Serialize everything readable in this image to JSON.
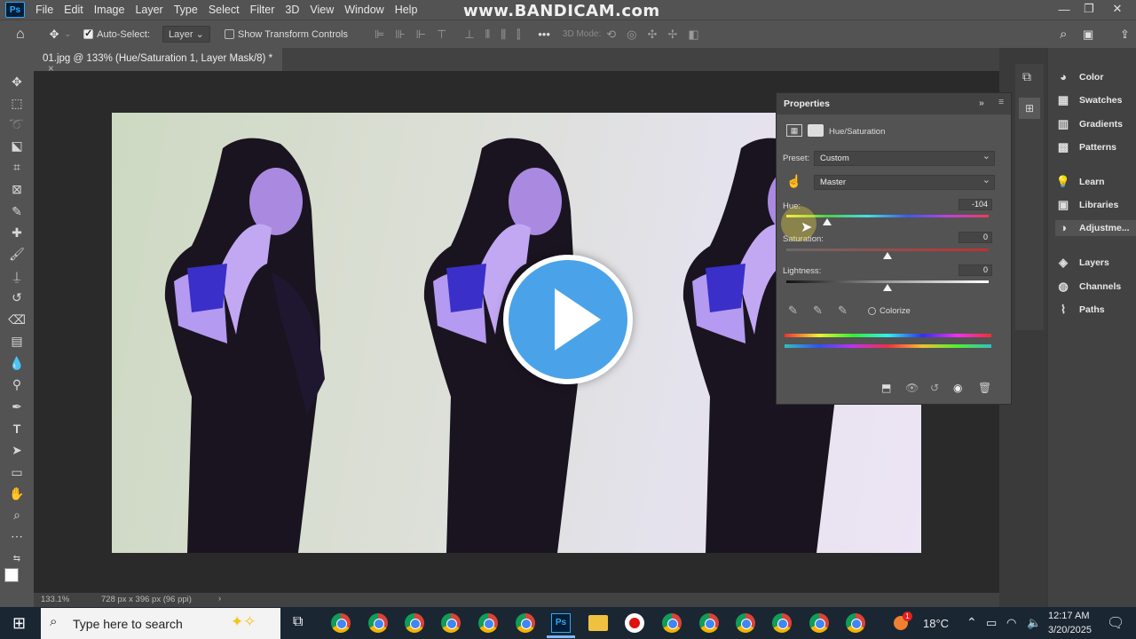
{
  "watermark": "www.BANDICAM.com",
  "menu": [
    "File",
    "Edit",
    "Image",
    "Layer",
    "Type",
    "Select",
    "Filter",
    "3D",
    "View",
    "Window",
    "Help"
  ],
  "options": {
    "auto_select_label": "Auto-Select:",
    "auto_select_value": "Layer",
    "transform_label": "Show Transform Controls",
    "mode3d_label": "3D Mode:"
  },
  "document": {
    "tab_title": "01.jpg @ 133% (Hue/Saturation 1, Layer Mask/8) *",
    "zoom": "133.1%",
    "dimensions": "728 px x 396 px (96 ppi)"
  },
  "right_panels": [
    {
      "label": "Color",
      "icon": "color-wheel-icon"
    },
    {
      "label": "Swatches",
      "icon": "grid-icon"
    },
    {
      "label": "Gradients",
      "icon": "gradient-icon"
    },
    {
      "label": "Patterns",
      "icon": "pattern-icon"
    },
    {
      "label": "Learn",
      "icon": "lightbulb-icon"
    },
    {
      "label": "Libraries",
      "icon": "library-icon"
    },
    {
      "label": "Adjustme...",
      "icon": "adjustment-icon"
    },
    {
      "label": "Layers",
      "icon": "layers-icon"
    },
    {
      "label": "Channels",
      "icon": "channels-icon"
    },
    {
      "label": "Paths",
      "icon": "paths-icon"
    }
  ],
  "properties": {
    "title": "Properties",
    "adjustment_name": "Hue/Saturation",
    "preset_label": "Preset:",
    "preset_value": "Custom",
    "channel_value": "Master",
    "hue_label": "Hue:",
    "hue_value": "-104",
    "saturation_label": "Saturation:",
    "saturation_value": "0",
    "lightness_label": "Lightness:",
    "lightness_value": "0",
    "colorize_label": "Colorize"
  },
  "taskbar": {
    "search_placeholder": "Type here to search",
    "weather": "18°C",
    "time": "12:17 AM",
    "date": "3/20/2025",
    "notification_badge": "1"
  }
}
